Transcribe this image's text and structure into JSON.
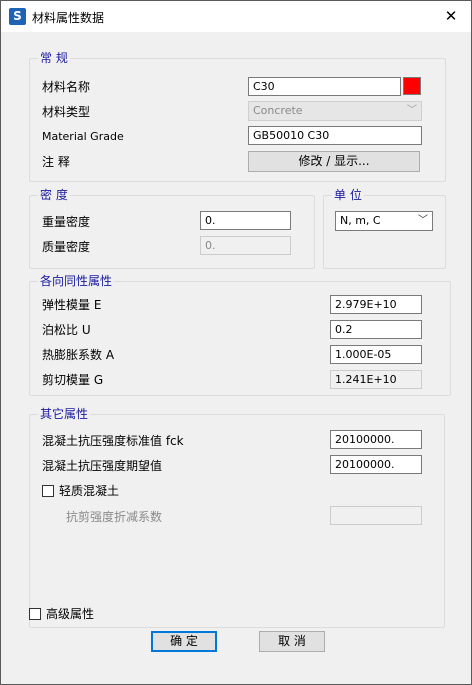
{
  "window": {
    "title": "材料属性数据",
    "app_icon": "S",
    "close_symbol": "✕"
  },
  "general": {
    "title": "常 规",
    "name_label": "材料名称",
    "name_value": "C30",
    "color_swatch": "#ff0000",
    "type_label": "材料类型",
    "type_value": "Concrete",
    "grade_label": "Material Grade",
    "grade_value": "GB50010 C30",
    "note_label": "注 释",
    "note_button": "修改 / 显示..."
  },
  "density": {
    "title": "密 度",
    "weight_label": "重量密度",
    "weight_value": "0.",
    "mass_label": "质量密度",
    "mass_value": "0."
  },
  "units": {
    "title": "单 位",
    "value": "N, m, C"
  },
  "isotropic": {
    "title": "各向同性属性",
    "modulus_label": "弹性模量 E",
    "modulus_value": "2.979E+10",
    "poisson_label": "泊松比 U",
    "poisson_value": "0.2",
    "thermal_label": "热膨胀系数 A",
    "thermal_value": "1.000E-05",
    "shear_label": "剪切模量 G",
    "shear_value": "1.241E+10"
  },
  "other": {
    "title": "其它属性",
    "fck_label": "混凝土抗压强度标准值 fck",
    "fck_value": "20100000.",
    "expected_label": "混凝土抗压强度期望值",
    "expected_value": "20100000.",
    "lightweight_label": "轻质混凝土",
    "shear_reduction_label": "抗剪强度折减系数",
    "shear_reduction_value": ""
  },
  "footer": {
    "advanced_label": "高级属性",
    "ok_label": "确 定",
    "cancel_label": "取 消"
  }
}
